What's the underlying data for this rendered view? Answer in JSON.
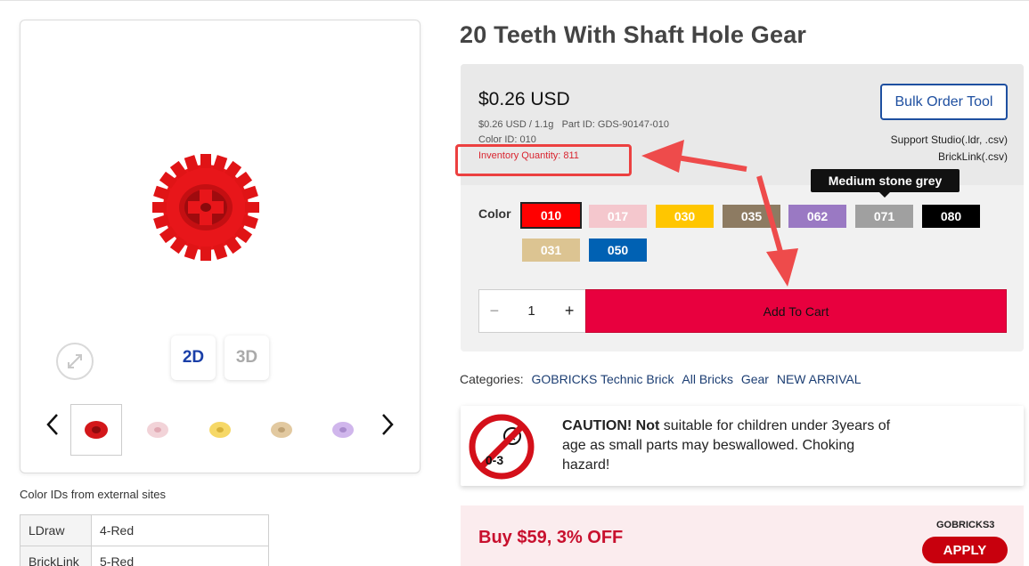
{
  "product": {
    "title": "20 Teeth With Shaft Hole Gear"
  },
  "viewer": {
    "mode_2d": "2D",
    "mode_3d": "3D",
    "thumb_colors": [
      "#d3171a",
      "#f2c4cc",
      "#f5cd4f",
      "#dcbf8e",
      "#c7a8e3"
    ]
  },
  "pricing": {
    "price": "$0.26 USD",
    "price_weight": "$0.26 USD / 1.1g",
    "part_id": "Part ID: GDS-90147-010",
    "color_id": "Color ID: 010",
    "inventory": "Inventory Quantity: 811",
    "bulk_button": "Bulk Order Tool",
    "support_line": "Support Studio(.ldr, .csv)",
    "bricklink_line": "BrickLink(.csv)"
  },
  "colors": {
    "label": "Color",
    "tooltip": "Medium stone grey",
    "swatches": [
      {
        "code": "010",
        "bg": "#ff0000",
        "fg": "#ffffff"
      },
      {
        "code": "017",
        "bg": "#f4c7cd",
        "fg": "#ffffff"
      },
      {
        "code": "030",
        "bg": "#ffc600",
        "fg": "#ffffff"
      },
      {
        "code": "035",
        "bg": "#8d7b62",
        "fg": "#ffffff"
      },
      {
        "code": "062",
        "bg": "#9a79c3",
        "fg": "#ffffff"
      },
      {
        "code": "071",
        "bg": "#a0a0a0",
        "fg": "#ffffff"
      },
      {
        "code": "080",
        "bg": "#000000",
        "fg": "#ffffff"
      },
      {
        "code": "031",
        "bg": "#dcc492",
        "fg": "#ffffff"
      },
      {
        "code": "050",
        "bg": "#0061b3",
        "fg": "#ffffff"
      }
    ]
  },
  "cart": {
    "minus": "−",
    "quantity": "1",
    "plus": "+",
    "add_to_cart": "Add To Cart"
  },
  "categories": {
    "label": "Categories:",
    "items": [
      "GOBRICKS Technic Brick",
      "All Bricks",
      "Gear",
      "NEW ARRIVAL"
    ]
  },
  "caution": {
    "bold": "CAUTION! Not",
    "text": " suitable for children under 3years of age as small parts may beswallowed. Choking hazard!",
    "icon_label": "0-3"
  },
  "promo": {
    "text": "Buy $59, 3% OFF",
    "code": "GOBRICKS3",
    "apply": "APPLY"
  },
  "external": {
    "title": "Color IDs from external sites",
    "rows": [
      {
        "site": "LDraw",
        "value": "4-Red"
      },
      {
        "site": "BrickLink",
        "value": "5-Red"
      }
    ]
  },
  "colors_accent": {
    "brand_red": "#e8003e",
    "link_blue": "#1e4fa0"
  }
}
